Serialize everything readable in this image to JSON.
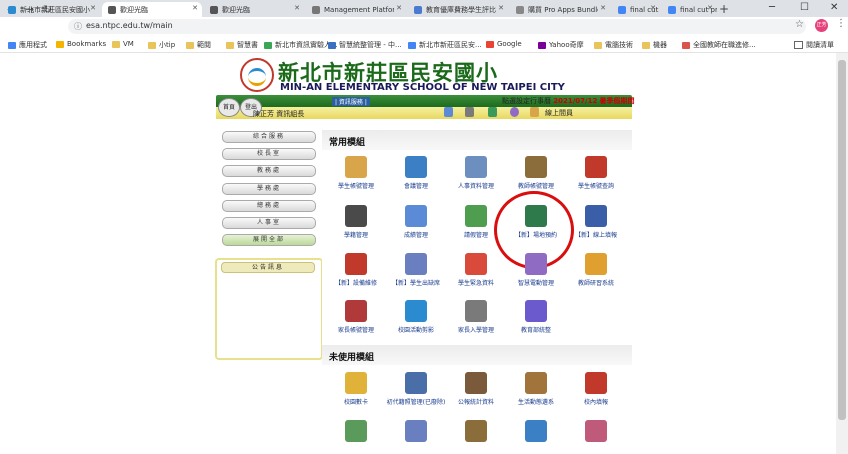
{
  "browser": {
    "tabs": [
      {
        "label": "新北市新莊區民安國小",
        "active": false,
        "color": "#2a8bd1"
      },
      {
        "label": "歡迎光臨",
        "active": true,
        "color": "#555555"
      },
      {
        "label": "歡迎光臨",
        "active": false,
        "color": "#555555"
      },
      {
        "label": "Management Platform",
        "active": false,
        "color": "#777777"
      },
      {
        "label": "教育優庫費務學生評比",
        "active": false,
        "color": "#4a7bd0"
      },
      {
        "label": "購買 Pro Apps Bundle",
        "active": false,
        "color": "#888888"
      },
      {
        "label": "final cut pro vs final c",
        "active": false,
        "color": "#4285f4"
      },
      {
        "label": "final cut pro vs final c",
        "active": false,
        "color": "#4285f4"
      }
    ],
    "url": "esa.ntpc.edu.tw/main",
    "profile_initials": "正芳",
    "bookmarks": [
      {
        "label": "應用程式",
        "color": "#4285f4"
      },
      {
        "label": "Bookmarks",
        "color": "#f4b400"
      },
      {
        "label": "VM",
        "color": "#e8c45a"
      },
      {
        "label": "小tip",
        "color": "#e8c45a"
      },
      {
        "label": "範閱",
        "color": "#e8c45a"
      },
      {
        "label": "智慧書",
        "color": "#e8c45a"
      },
      {
        "label": "新北市資訊實驗人...",
        "color": "#3aa757"
      },
      {
        "label": "智慧統整管理 - 中...",
        "color": "#3a6fc1"
      },
      {
        "label": "新北市新莊區民安...",
        "color": "#4285f4"
      },
      {
        "label": "Google",
        "color": "#ea4335"
      },
      {
        "label": "Yahoo奇摩",
        "color": "#7b0099"
      },
      {
        "label": "電腦技術",
        "color": "#e8c45a"
      },
      {
        "label": "機器",
        "color": "#e8c45a"
      },
      {
        "label": "全國教師在職進修...",
        "color": "#d9534f"
      }
    ],
    "reading_list": "閱讀清單"
  },
  "school": {
    "name_cn": "新北市新莊區民安國小",
    "name_en": "MIN-AN ELEMENTARY SCHOOL OF NEW TAIPEI CITY",
    "home_btn": "首頁",
    "logout_btn": "登出",
    "service_link": "| 資訊服務 |",
    "date_prefix": "點選設定行事曆",
    "date": "2021/07/12",
    "date_suffix": "暑季假期間",
    "user": "陳正芳 資訊組長",
    "online_label": "線上間員"
  },
  "sidebar": {
    "items": [
      {
        "label": "綜合服務",
        "active": false
      },
      {
        "label": "校長室",
        "active": false
      },
      {
        "label": "教務處",
        "active": false
      },
      {
        "label": "學務處",
        "active": false
      },
      {
        "label": "總務處",
        "active": false
      },
      {
        "label": "人事室",
        "active": false
      },
      {
        "label": "展開全部",
        "active": true
      }
    ],
    "notice_title": "公告訊息"
  },
  "sections": {
    "common_title": "常用模組",
    "unused_title": "未使用模組"
  },
  "modules_common": [
    {
      "label": "學生帳號管理",
      "color": "#d9a54a"
    },
    {
      "label": "會議管理",
      "color": "#3b7fc4"
    },
    {
      "label": "人事資料管理",
      "color": "#6d8fbf"
    },
    {
      "label": "教師帳號管理",
      "color": "#8a6d3b"
    },
    {
      "label": "學生帳號查詢",
      "color": "#c0392b"
    },
    {
      "label": "學籍管理",
      "color": "#4a4a4a"
    },
    {
      "label": "成績管理",
      "color": "#5b8ad6"
    },
    {
      "label": "請假管理",
      "color": "#4f9d4f"
    },
    {
      "label": "【新】場地預約",
      "color": "#2f7a4a"
    },
    {
      "label": "【新】線上填報",
      "color": "#3a5fa8"
    },
    {
      "label": "【新】設備維修",
      "color": "#c0392b"
    },
    {
      "label": "【新】學生出缺席",
      "color": "#6a7fbf"
    },
    {
      "label": "學生緊急資料",
      "color": "#d94a3a"
    },
    {
      "label": "智慧電動管理",
      "color": "#8f6bc4"
    },
    {
      "label": "教師研習系統",
      "color": "#e0a030"
    },
    {
      "label": "家長帳號管理",
      "color": "#b03a3a"
    },
    {
      "label": "校園活動剪影",
      "color": "#2a8bd1"
    },
    {
      "label": "家長入學管理",
      "color": "#7a7a7a"
    },
    {
      "label": "教育部統整",
      "color": "#6a5acd"
    }
  ],
  "modules_unused": [
    {
      "label": "校園數卡",
      "color": "#e0b23a"
    },
    {
      "label": "初代籍照管理(已廢除)",
      "color": "#4a6fa8"
    },
    {
      "label": "公報統計資料",
      "color": "#7a5a3a"
    },
    {
      "label": "生活動態遴系",
      "color": "#a0743a"
    },
    {
      "label": "校內填報",
      "color": "#c0392b"
    },
    {
      "label": "",
      "color": "#5a9a5a"
    },
    {
      "label": "",
      "color": "#6a7fbf"
    },
    {
      "label": "",
      "color": "#8a6d3b"
    },
    {
      "label": "",
      "color": "#3b7fc4"
    },
    {
      "label": "",
      "color": "#c05a7a"
    }
  ]
}
